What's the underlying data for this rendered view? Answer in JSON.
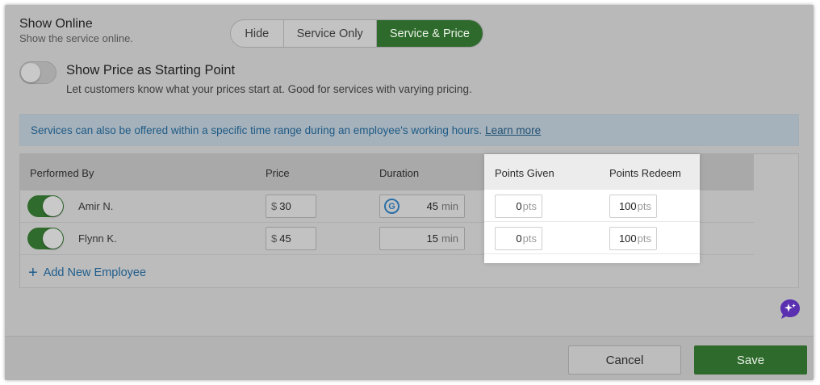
{
  "show_online": {
    "title": "Show Online",
    "subtitle": "Show the service online.",
    "options": [
      "Hide",
      "Service Only",
      "Service & Price"
    ],
    "selected": "Service & Price"
  },
  "price_starting": {
    "title": "Show Price as Starting Point",
    "subtitle": "Let customers know what your prices start at. Good for services with varying pricing.",
    "enabled": false
  },
  "banner": {
    "text": "Services can also be offered within a specific time range during an employee's working hours.",
    "link": "Learn more"
  },
  "table": {
    "headers": {
      "performed_by": "Performed By",
      "price": "Price",
      "duration": "Duration",
      "points_given": "Points Given",
      "points_redeem": "Points Redeem"
    },
    "currency": "$",
    "duration_unit": "min",
    "points_unit": "pts",
    "rows": [
      {
        "name": "Amir N.",
        "enabled": true,
        "price": "30",
        "duration": "45",
        "has_g": true,
        "points_given": "0",
        "points_redeem": "100"
      },
      {
        "name": "Flynn K.",
        "enabled": true,
        "price": "45",
        "duration": "15",
        "has_g": false,
        "points_given": "0",
        "points_redeem": "100"
      }
    ],
    "add_employee": "Add New Employee",
    "g_icon_letter": "G"
  },
  "footer": {
    "cancel": "Cancel",
    "save": "Save"
  },
  "colors": {
    "accent_green": "#2e6a2c",
    "link_blue": "#1f5d8c"
  }
}
